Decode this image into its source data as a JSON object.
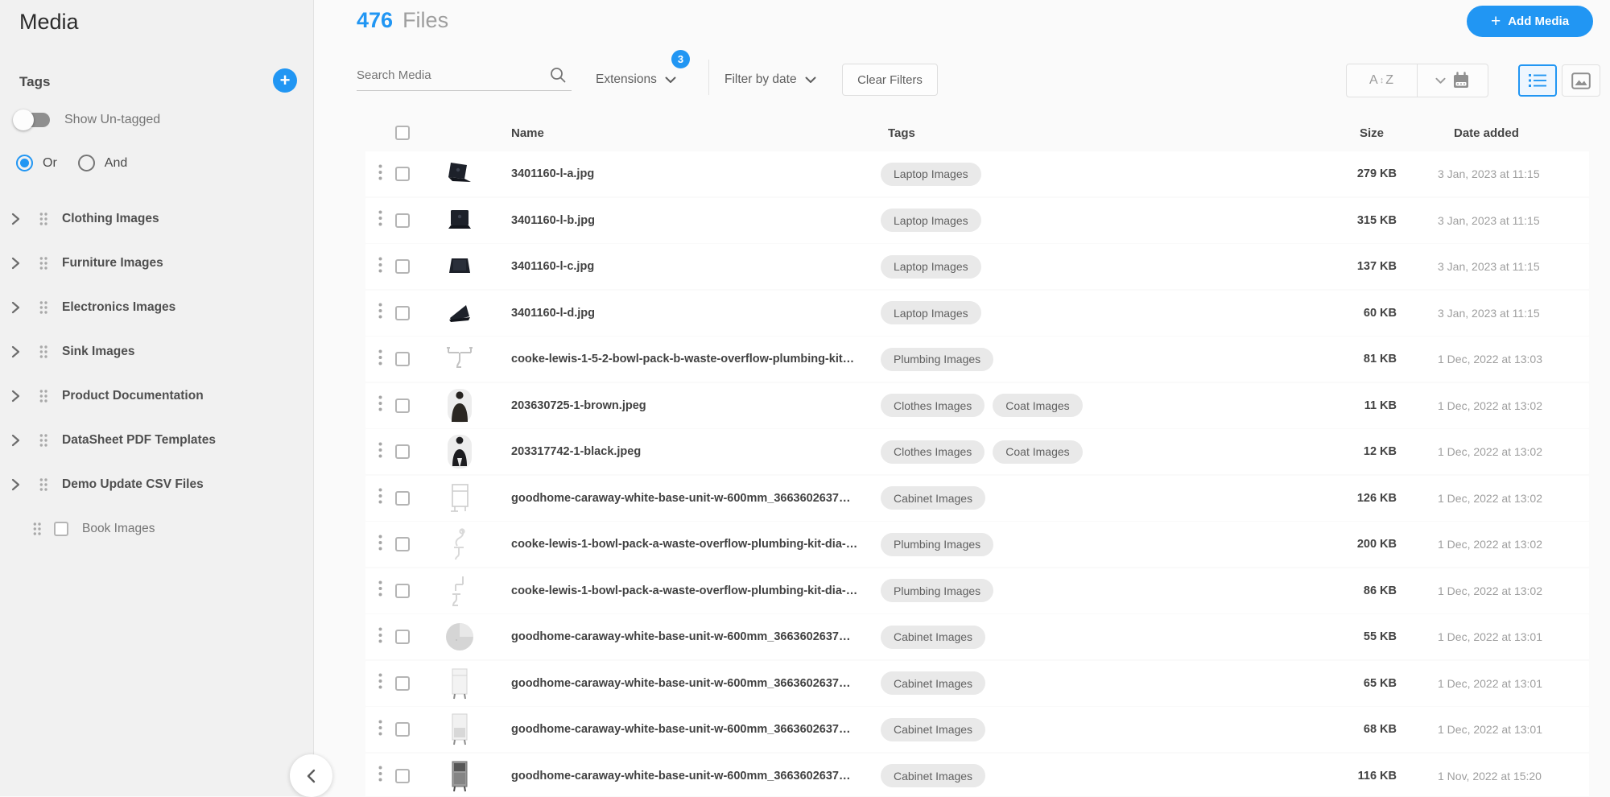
{
  "colors": {
    "accent": "#2196f3",
    "tag_pill_bg": "#e9e9e9"
  },
  "app": {
    "title": "Media"
  },
  "sidebar": {
    "tags_header": "Tags",
    "show_untagged_label": "Show Un-tagged",
    "show_untagged_on": false,
    "or_label": "Or",
    "and_label": "And",
    "match_mode_selected": "Or",
    "tags": [
      "Clothing Images",
      "Furniture Images",
      "Electronics Images",
      "Sink Images",
      "Product Documentation",
      "DataSheet PDF Templates",
      "Demo Update CSV Files"
    ],
    "nested_tag": "Book Images"
  },
  "header": {
    "file_count": "476",
    "files_label": "Files",
    "add_media_label": "Add Media",
    "add_media_plus": "+"
  },
  "filter_bar": {
    "search_placeholder": "Search Media",
    "extensions_label": "Extensions",
    "extensions_badge": "3",
    "filter_by_date_label": "Filter by date",
    "clear_filters_label": "Clear Filters",
    "sort_alpha_a": "A",
    "sort_alpha_z": "Z",
    "active_view": "list"
  },
  "table": {
    "columns": {
      "name": "Name",
      "tags": "Tags",
      "size": "Size",
      "date": "Date added"
    },
    "rows": [
      {
        "name": "3401160-l-a.jpg",
        "tags": [
          "Laptop Images"
        ],
        "size": "279 KB",
        "date": "3 Jan, 2023 at 11:15",
        "thumb": "laptop-open-angled-icon"
      },
      {
        "name": "3401160-l-b.jpg",
        "tags": [
          "Laptop Images"
        ],
        "size": "315 KB",
        "date": "3 Jan, 2023 at 11:15",
        "thumb": "laptop-front-icon"
      },
      {
        "name": "3401160-l-c.jpg",
        "tags": [
          "Laptop Images"
        ],
        "size": "137 KB",
        "date": "3 Jan, 2023 at 11:15",
        "thumb": "laptop-back-icon"
      },
      {
        "name": "3401160-l-d.jpg",
        "tags": [
          "Laptop Images"
        ],
        "size": "60 KB",
        "date": "3 Jan, 2023 at 11:15",
        "thumb": "laptop-closed-icon"
      },
      {
        "name": "cooke-lewis-1-5-2-bowl-pack-b-waste-overflow-plumbing-kit…",
        "tags": [
          "Plumbing Images"
        ],
        "size": "81 KB",
        "date": "1 Dec, 2022 at 13:03",
        "thumb": "plumbing-diagram-icon"
      },
      {
        "name": "203630725-1-brown.jpeg",
        "tags": [
          "Clothes Images",
          "Coat Images"
        ],
        "size": "11 KB",
        "date": "1 Dec, 2022 at 13:02",
        "thumb": "person-coat-brown-icon"
      },
      {
        "name": "203317742-1-black.jpeg",
        "tags": [
          "Clothes Images",
          "Coat Images"
        ],
        "size": "12 KB",
        "date": "1 Dec, 2022 at 13:02",
        "thumb": "person-coat-black-icon"
      },
      {
        "name": "goodhome-caraway-white-base-unit-w-600mm_3663602637…",
        "tags": [
          "Cabinet Images"
        ],
        "size": "126 KB",
        "date": "1 Dec, 2022 at 13:02",
        "thumb": "cabinet-sketch-icon"
      },
      {
        "name": "cooke-lewis-1-bowl-pack-a-waste-overflow-plumbing-kit-dia-…",
        "tags": [
          "Plumbing Images"
        ],
        "size": "200 KB",
        "date": "1 Dec, 2022 at 13:02",
        "thumb": "plumbing-faint-icon"
      },
      {
        "name": "cooke-lewis-1-bowl-pack-a-waste-overflow-plumbing-kit-dia-…",
        "tags": [
          "Plumbing Images"
        ],
        "size": "86 KB",
        "date": "1 Dec, 2022 at 13:02",
        "thumb": "plumbing-faint2-icon"
      },
      {
        "name": "goodhome-caraway-white-base-unit-w-600mm_3663602637…",
        "tags": [
          "Cabinet Images"
        ],
        "size": "55 KB",
        "date": "1 Dec, 2022 at 13:01",
        "thumb": "cabinet-round-icon"
      },
      {
        "name": "goodhome-caraway-white-base-unit-w-600mm_3663602637…",
        "tags": [
          "Cabinet Images"
        ],
        "size": "65 KB",
        "date": "1 Dec, 2022 at 13:01",
        "thumb": "cabinet-white-icon"
      },
      {
        "name": "goodhome-caraway-white-base-unit-w-600mm_3663602637…",
        "tags": [
          "Cabinet Images"
        ],
        "size": "68 KB",
        "date": "1 Dec, 2022 at 13:01",
        "thumb": "cabinet-open-icon"
      },
      {
        "name": "goodhome-caraway-white-base-unit-w-600mm_3663602637…",
        "tags": [
          "Cabinet Images"
        ],
        "size": "116 KB",
        "date": "1 Nov, 2022 at 15:20",
        "thumb": "cabinet-dark-icon"
      }
    ]
  }
}
